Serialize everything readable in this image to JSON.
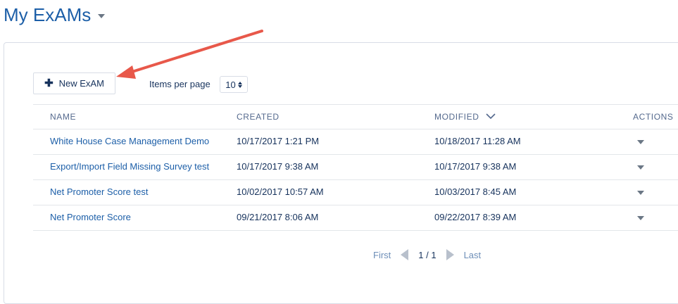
{
  "header": {
    "title": "My ExAMs"
  },
  "toolbar": {
    "new_button_icon": "plus-icon",
    "new_button_label": "New ExAM",
    "items_per_page_label": "Items per page",
    "items_per_page_value": "10"
  },
  "table": {
    "columns": {
      "name": "NAME",
      "created": "CREATED",
      "modified": "MODIFIED",
      "actions": "ACTIONS"
    },
    "sorted_column": "modified",
    "sort_direction": "desc",
    "rows": [
      {
        "name": "White House Case Management Demo",
        "created": "10/17/2017 1:21 PM",
        "modified": "10/18/2017 11:28 AM"
      },
      {
        "name": "Export/Import Field Missing Survey test",
        "created": "10/17/2017 9:38 AM",
        "modified": "10/17/2017 9:38 AM"
      },
      {
        "name": "Net Promoter Score test",
        "created": "10/02/2017 10:57 AM",
        "modified": "10/03/2017 8:45 AM"
      },
      {
        "name": "Net Promoter Score",
        "created": "09/21/2017 8:06 AM",
        "modified": "09/22/2017 8:39 AM"
      }
    ]
  },
  "pagination": {
    "first": "First",
    "page_info": "1 / 1",
    "last": "Last"
  },
  "annotation": {
    "color": "#e8584a",
    "points_to": "new-exam-button"
  },
  "colors": {
    "link": "#1d5fa8",
    "text": "#16325c",
    "border": "#d8dde6"
  }
}
